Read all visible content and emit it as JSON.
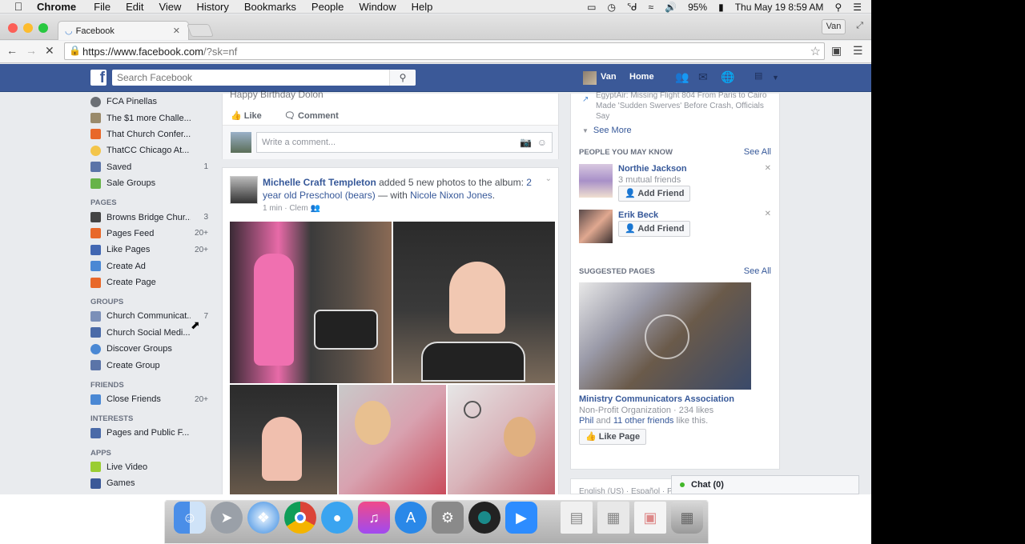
{
  "menubar": {
    "app": "Chrome",
    "items": [
      "File",
      "Edit",
      "View",
      "History",
      "Bookmarks",
      "People",
      "Window",
      "Help"
    ],
    "battery": "95%",
    "datetime": "Thu May 19  8:59 AM"
  },
  "browser": {
    "tab_title": "Facebook",
    "profile": "Van",
    "url_host": "https://www.facebook.com",
    "url_path": "/?sk=nf"
  },
  "fb_header": {
    "logo": "f",
    "search_placeholder": "Search Facebook",
    "user_name": "Van",
    "home_label": "Home"
  },
  "left_nav": {
    "top_items": [
      {
        "label": "FCA Pinellas",
        "count": "",
        "color": "#6b6f74"
      },
      {
        "label": "The $1 more Challe...",
        "count": "",
        "color": "#9a8a6a"
      },
      {
        "label": "That Church Confer...",
        "count": "",
        "color": "#e8682a"
      },
      {
        "label": "ThatCC Chicago At...",
        "count": "",
        "color": "#f3c54a"
      },
      {
        "label": "Saved",
        "count": "1",
        "color": "#5b74a8"
      },
      {
        "label": "Sale Groups",
        "count": "",
        "color": "#67b349"
      }
    ],
    "pages_head": "PAGES",
    "pages": [
      {
        "label": "Browns Bridge Chur...",
        "count": "3",
        "color": "#444444"
      },
      {
        "label": "Pages Feed",
        "count": "20+",
        "color": "#e8682a"
      },
      {
        "label": "Like Pages",
        "count": "20+",
        "color": "#4267b2"
      },
      {
        "label": "Create Ad",
        "count": "",
        "color": "#4a88d4"
      },
      {
        "label": "Create Page",
        "count": "",
        "color": "#e8682a"
      }
    ],
    "groups_head": "GROUPS",
    "groups": [
      {
        "label": "Church Communicat...",
        "count": "7",
        "color": "#7b8fb8"
      },
      {
        "label": "Church Social Medi...",
        "count": "",
        "color": "#4a6aa8"
      },
      {
        "label": "Discover Groups",
        "count": "",
        "color": "#4a88d4"
      },
      {
        "label": "Create Group",
        "count": "",
        "color": "#5b74a8"
      }
    ],
    "friends_head": "FRIENDS",
    "friends": [
      {
        "label": "Close Friends",
        "count": "20+",
        "color": "#4a88d4"
      }
    ],
    "interests_head": "INTERESTS",
    "interests": [
      {
        "label": "Pages and Public F...",
        "count": "",
        "color": "#4a6aa8"
      }
    ],
    "apps_head": "APPS",
    "apps": [
      {
        "label": "Live Video",
        "count": "",
        "color": "#9acd32"
      },
      {
        "label": "Games",
        "count": "",
        "color": "#3b5998"
      }
    ]
  },
  "feed": {
    "prev_post_text": "Happy Birthday Dolon",
    "like_label": "Like",
    "comment_label": "Comment",
    "comment_placeholder": "Write a comment...",
    "post": {
      "author": "Michelle Craft Templeton",
      "action": " added 5 new photos to the album: ",
      "album": "2 year old Preschool (bears)",
      "with": " — with ",
      "tagged": "Nicole Nixon Jones",
      "end": ".",
      "meta": "1 min · Clem"
    }
  },
  "right_col": {
    "news_item": "EgyptAir: Missing Flight 804 From Paris to Cairo Made 'Sudden Swerves' Before Crash, Officials Say",
    "see_more": "See More",
    "pymk_head": "PEOPLE YOU MAY KNOW",
    "see_all": "See All",
    "people": [
      {
        "name": "Northie Jackson",
        "sub": "3 mutual friends",
        "add": "Add Friend"
      },
      {
        "name": "Erik Beck",
        "sub": "",
        "add": "Add Friend"
      }
    ],
    "suggested_head": "SUGGESTED PAGES",
    "page_name": "Ministry Communicators Association",
    "page_sub": "Non-Profit Organization · 234 likes",
    "page_friend_a": "Phil",
    "page_friend_mid": " and ",
    "page_friend_b": "11 other friends",
    "page_friend_end": " like this.",
    "like_page": "Like Page"
  },
  "footer_text": "English (US) · Español · P",
  "chat_label": "Chat (0)"
}
